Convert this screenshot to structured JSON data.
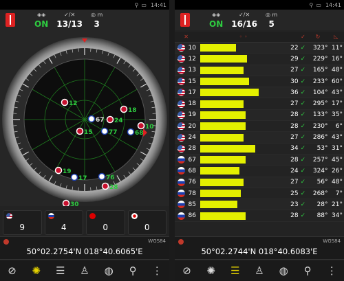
{
  "status": {
    "time": "14:41"
  },
  "left": {
    "header": {
      "state": "ON",
      "sats": "13/13",
      "accuracy": "3"
    },
    "dial": {
      "sats": [
        {
          "id": "12",
          "flag": "us",
          "green": true
        },
        {
          "id": "67",
          "flag": "ru",
          "green": false
        },
        {
          "id": "24",
          "flag": "us",
          "green": true
        },
        {
          "id": "18",
          "flag": "us",
          "green": true
        },
        {
          "id": "15",
          "flag": "us",
          "green": true
        },
        {
          "id": "77",
          "flag": "ru",
          "green": true
        },
        {
          "id": "68",
          "flag": "ru",
          "green": true
        },
        {
          "id": "10",
          "flag": "us",
          "green": true
        },
        {
          "id": "19",
          "flag": "us",
          "green": true
        },
        {
          "id": "17",
          "flag": "ru",
          "green": true
        },
        {
          "id": "76",
          "flag": "ru",
          "green": true
        },
        {
          "id": "28",
          "flag": "us",
          "green": true
        },
        {
          "id": "30",
          "flag": "us",
          "green": true
        }
      ]
    },
    "counts": [
      {
        "flag": "us",
        "value": "9"
      },
      {
        "flag": "ru",
        "value": "4"
      },
      {
        "flag": "cn",
        "value": "0"
      },
      {
        "flag": "jp",
        "value": "0"
      }
    ],
    "datum": "WGS84",
    "coords": "50°02.2754'N  018°40.6065'E"
  },
  "right": {
    "header": {
      "state": "ON",
      "sats": "16/16",
      "accuracy": "5"
    },
    "rows": [
      {
        "flag": "us",
        "id": "10",
        "bar": 0.4,
        "snr": "22",
        "az": "323°",
        "el": "11°"
      },
      {
        "flag": "us",
        "id": "12",
        "bar": 0.53,
        "snr": "29",
        "az": "229°",
        "el": "16°"
      },
      {
        "flag": "us",
        "id": "13",
        "bar": 0.49,
        "snr": "27",
        "az": "165°",
        "el": "48°"
      },
      {
        "flag": "us",
        "id": "15",
        "bar": 0.55,
        "snr": "30",
        "az": "233°",
        "el": "60°"
      },
      {
        "flag": "us",
        "id": "17",
        "bar": 0.66,
        "snr": "36",
        "az": "104°",
        "el": "43°"
      },
      {
        "flag": "us",
        "id": "18",
        "bar": 0.49,
        "snr": "27",
        "az": "295°",
        "el": "17°"
      },
      {
        "flag": "us",
        "id": "19",
        "bar": 0.51,
        "snr": "28",
        "az": "133°",
        "el": "35°"
      },
      {
        "flag": "us",
        "id": "20",
        "bar": 0.51,
        "snr": "28",
        "az": "230°",
        "el": "6°"
      },
      {
        "flag": "us",
        "id": "24",
        "bar": 0.49,
        "snr": "27",
        "az": "286°",
        "el": "43°"
      },
      {
        "flag": "us",
        "id": "28",
        "bar": 0.62,
        "snr": "34",
        "az": "53°",
        "el": "31°"
      },
      {
        "flag": "ru",
        "id": "67",
        "bar": 0.51,
        "snr": "28",
        "az": "257°",
        "el": "45°"
      },
      {
        "flag": "ru",
        "id": "68",
        "bar": 0.44,
        "snr": "24",
        "az": "324°",
        "el": "26°"
      },
      {
        "flag": "ru",
        "id": "76",
        "bar": 0.49,
        "snr": "27",
        "az": "56°",
        "el": "48°"
      },
      {
        "flag": "ru",
        "id": "78",
        "bar": 0.46,
        "snr": "25",
        "az": "268°",
        "el": "7°"
      },
      {
        "flag": "ru",
        "id": "85",
        "bar": 0.42,
        "snr": "23",
        "az": "28°",
        "el": "21°"
      },
      {
        "flag": "ru",
        "id": "86",
        "bar": 0.51,
        "snr": "28",
        "az": "88°",
        "el": "34°"
      }
    ],
    "datum": "WGS84",
    "coords": "50°02.2744'N  018°40.6083'E"
  },
  "colors": {
    "green": "#2ecc40",
    "bar": "#e4f000",
    "accent_red": "#c0392b"
  },
  "toolbar_icons": [
    "compass-icon",
    "satellite-radar-icon",
    "signal-bars-icon",
    "walk-icon",
    "globe-icon",
    "location-pin-icon",
    "more-menu-icon"
  ]
}
